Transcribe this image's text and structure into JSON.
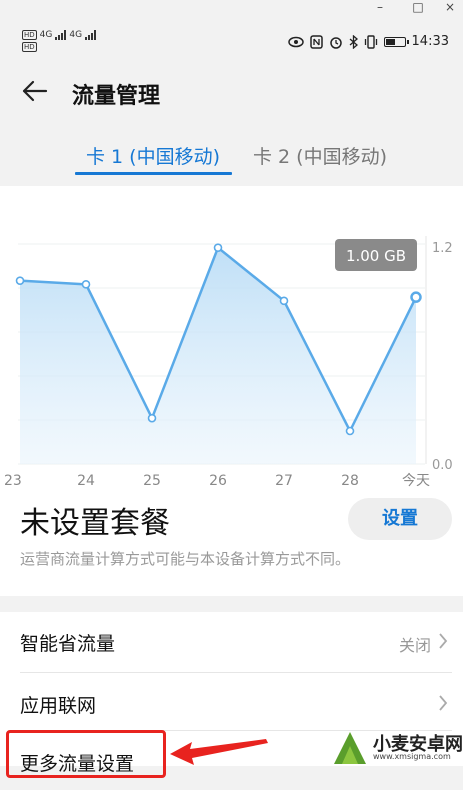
{
  "window": {
    "minimize": "–",
    "maximize": "□",
    "close": "×"
  },
  "status_bar": {
    "sim1_badge": "HD",
    "sim2_badge": "HD",
    "net1": "4G",
    "net2": "4G",
    "time": "14:33",
    "battery_level": 0.55,
    "icons": [
      "eye-icon",
      "nfc-icon",
      "alarm-icon",
      "bluetooth-icon",
      "vibrate-icon",
      "battery-icon"
    ]
  },
  "app_bar": {
    "title": "流量管理",
    "back_icon": "arrow-left-icon"
  },
  "tabs": [
    {
      "label": "卡 1 (中国移动)",
      "active": true
    },
    {
      "label": "卡 2 (中国移动)",
      "active": false
    }
  ],
  "chart_data": {
    "type": "area",
    "categories": [
      "23",
      "24",
      "25",
      "26",
      "27",
      "28",
      "今天"
    ],
    "values": [
      1.0,
      0.98,
      0.25,
      1.18,
      0.89,
      0.18,
      0.91
    ],
    "y_tick_labels": [
      "1.2",
      "0.0"
    ],
    "ylim": [
      0,
      1.2
    ],
    "tooltip": "1.00 GB",
    "accent_color": "#5aaae8"
  },
  "plan": {
    "title": "未设置套餐",
    "set_button": "设置",
    "note": "运营商流量计算方式可能与本设备计算方式不同。"
  },
  "list": [
    {
      "label": "智能省流量",
      "value": "关闭"
    },
    {
      "label": "应用联网",
      "value": ""
    },
    {
      "label": "更多流量设置",
      "value": ""
    }
  ],
  "watermark": {
    "name": "小麦安卓网",
    "url": "www.xmsigma.com"
  },
  "colors": {
    "accent": "#1678d4",
    "highlight": "#e8231f"
  }
}
